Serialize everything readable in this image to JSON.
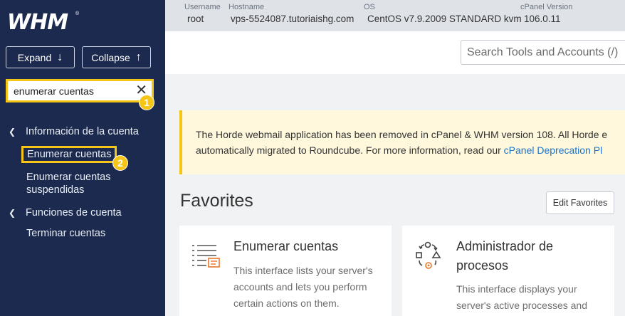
{
  "sidebar": {
    "logo": "WHM",
    "logo_mark": "®",
    "expand_label": "Expand",
    "collapse_label": "Collapse",
    "search_value": "enumerar cuentas",
    "annotation_1": "1",
    "annotation_2": "2",
    "sections": [
      {
        "label": "Información de la cuenta",
        "items": [
          "Enumerar cuentas",
          "Enumerar cuentas suspendidas"
        ]
      },
      {
        "label": "Funciones de cuenta",
        "items": [
          "Terminar cuentas"
        ]
      }
    ]
  },
  "server_info": {
    "username_label": "Username",
    "username": "root",
    "hostname_label": "Hostname",
    "hostname": "vps-5524087.tutoriaishg.com",
    "os_label": "OS",
    "os": "CentOS v7.9.2009 STANDARD kvm",
    "version_label": "cPanel Version",
    "version": "106.0.11"
  },
  "header": {
    "search_placeholder": "Search Tools and Accounts (/)"
  },
  "notice": {
    "line1": "The Horde webmail application has been removed in cPanel & WHM version 108. All Horde e",
    "line2": "automatically migrated to Roundcube. For more information, read our ",
    "link": "cPanel Deprecation Pl"
  },
  "favorites": {
    "title": "Favorites",
    "edit_label": "Edit Favorites",
    "cards": [
      {
        "title": "Enumerar cuentas",
        "desc": "This interface lists your server's accounts and lets you perform certain actions on them."
      },
      {
        "title": "Administrador de procesos",
        "desc": "This interface displays your server's active processes and"
      }
    ]
  },
  "colors": {
    "sidebar": "#1b2a4e",
    "highlight": "#f5c518",
    "link": "#1a73c9"
  }
}
